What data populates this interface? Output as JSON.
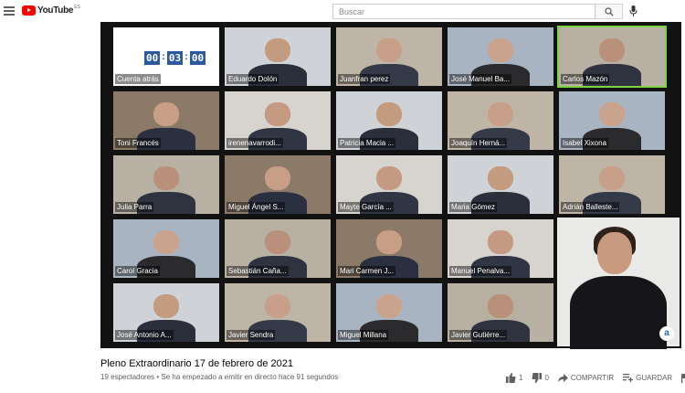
{
  "header": {
    "logo_text": "YouTube",
    "logo_region": "ES",
    "search_placeholder": "Buscar"
  },
  "icons": [
    "menu-icon",
    "search-icon",
    "mic-icon",
    "thumbs-up-icon",
    "thumbs-down-icon",
    "share-icon",
    "add-to-playlist-icon",
    "flag-icon"
  ],
  "video": {
    "countdown": [
      "00",
      "03",
      "00"
    ],
    "participants": [
      "Cuenta atrás",
      "Eduardo Dolón",
      "Juanfran perez",
      "José Manuel Ba...",
      "Carlos Mazón",
      "Toni Francés",
      "irenenavarrodi...",
      "Patricia Macia ...",
      "Joaquín Herná...",
      "Isabel Xixona",
      "Julia Parra",
      "Miguel Ángel S...",
      "Mayte García ...",
      "Maria Gómez",
      "Adrián Balleste...",
      "Carol Gracia",
      "Sebastián Caña...",
      "Mari Carmen J...",
      "Manuel Penalva...",
      "José Antonio A...",
      "Javier Sendra",
      "Miguel Millana",
      "Javier Gutiérre..."
    ],
    "active_speaker": "Carlos Mazón",
    "sign_logo": "a"
  },
  "info": {
    "title": "Pleno Extraordinario 17 de febrero de 2021",
    "viewers": "19 espectadores",
    "started": "Se ha empezado a emitir en directo hace 91 segundos",
    "likes": "1",
    "dislikes": "0",
    "share_label": "COMPARTIR",
    "save_label": "GUARDAR"
  }
}
